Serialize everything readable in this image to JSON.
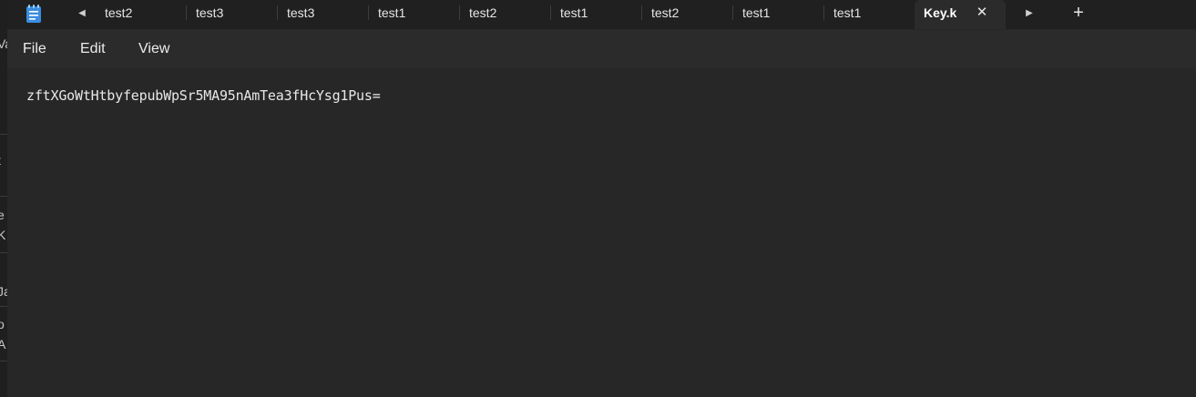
{
  "background_window": {
    "fragments": [
      "Va",
      "t",
      "e",
      "K",
      "Ja",
      "o",
      "A"
    ]
  },
  "tabbar": {
    "tabs": [
      {
        "label": "test2"
      },
      {
        "label": "test3"
      },
      {
        "label": "test3"
      },
      {
        "label": "test1"
      },
      {
        "label": "test2"
      },
      {
        "label": "test1"
      },
      {
        "label": "test2"
      },
      {
        "label": "test1"
      },
      {
        "label": "test1"
      }
    ],
    "active_tab": {
      "label": "Key.k"
    },
    "scroll_left_glyph": "◀",
    "scroll_right_glyph": "▶",
    "new_tab_glyph": "+",
    "close_glyph": "✕"
  },
  "menu": {
    "file": "File",
    "edit": "Edit",
    "view": "View"
  },
  "editor": {
    "content": "zftXGoWtHtbyfepubWpSr5MA95nAmTea3fHcYsg1Pus="
  },
  "colors": {
    "tabbar_bg": "#202020",
    "menubar_bg": "#2b2b2b",
    "editor_bg": "#272727",
    "app_icon": "#3b8de0"
  },
  "icons": {
    "app": "notepad-icon",
    "close": "close-icon",
    "scroll_left": "caret-left-icon",
    "scroll_right": "caret-right-icon",
    "new_tab": "plus-icon"
  }
}
